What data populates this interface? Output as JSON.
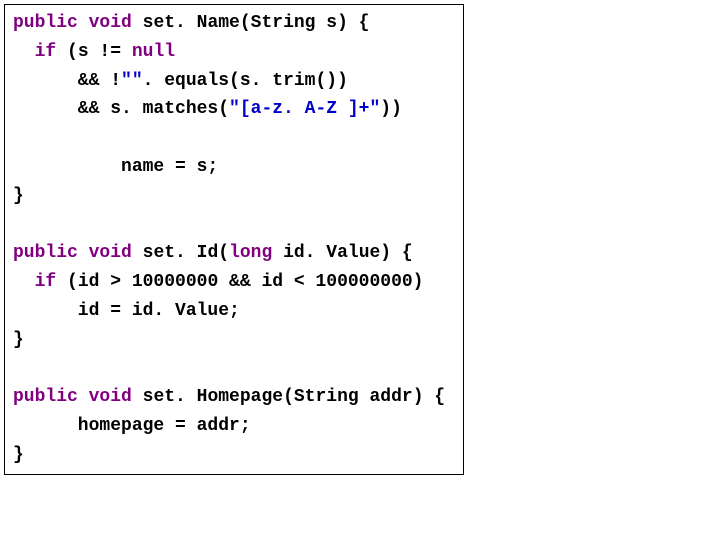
{
  "code": {
    "kw_public": "public",
    "kw_void": "void",
    "kw_if": "if",
    "kw_null": "null",
    "kw_long": "long",
    "line1_a": " set. Name(String s) {",
    "line2_a": "  ",
    "line2_b": " (s != ",
    "line3": "      && !",
    "line3_str": "\"\"",
    "line3_b": ". equals(s. trim())",
    "line4": "      && s. matches(",
    "line4_str": "\"[a-z. A-Z ]+\"",
    "line4_b": "))",
    "line6": "          name = s;",
    "line7": "}",
    "line9_a": " set. Id(",
    "line9_b": " id. Value) {",
    "line10_a": "  ",
    "line10_b": " (id > 10000000 && id < 100000000)",
    "line11": "      id = id. Value;",
    "line12": "}",
    "line14_a": " set. Homepage(String addr) {",
    "line15": "      homepage = addr;",
    "line16": "}"
  }
}
